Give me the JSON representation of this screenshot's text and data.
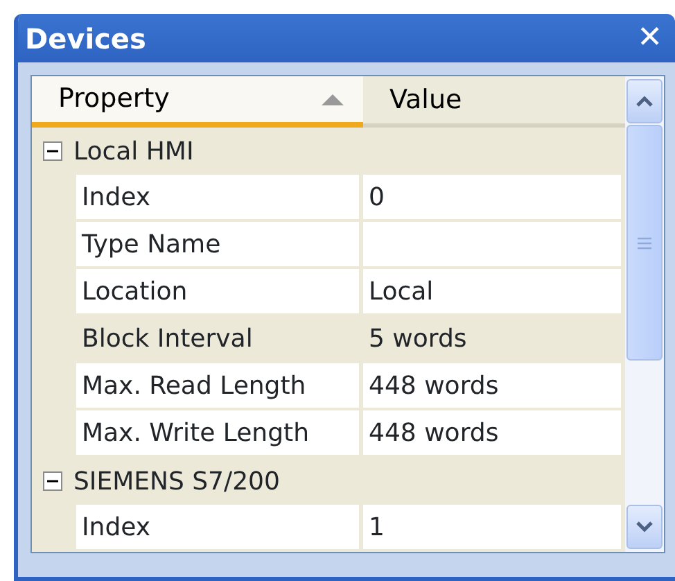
{
  "window": {
    "title": "Devices",
    "close": "✕"
  },
  "columns": [
    {
      "label": "Property",
      "sorted": true
    },
    {
      "label": "Value",
      "sorted": false
    }
  ],
  "groups": [
    {
      "label": "Local HMI",
      "expanded": true,
      "rows": [
        {
          "property": "Index",
          "value": "0",
          "selected": false
        },
        {
          "property": "Type Name",
          "selected": false
        },
        {
          "property": "Location",
          "value": "Local",
          "selected": false
        },
        {
          "property": "Block Interval",
          "value": "5 words",
          "selected": true
        },
        {
          "property": "Max. Read Length",
          "value": "448 words",
          "selected": false
        },
        {
          "property": "Max. Write Length",
          "value": "448 words",
          "selected": false
        }
      ]
    },
    {
      "label": "SIEMENS S7/200",
      "expanded": true,
      "rows": [
        {
          "property": "Index",
          "value": "1",
          "selected": false
        }
      ]
    }
  ]
}
